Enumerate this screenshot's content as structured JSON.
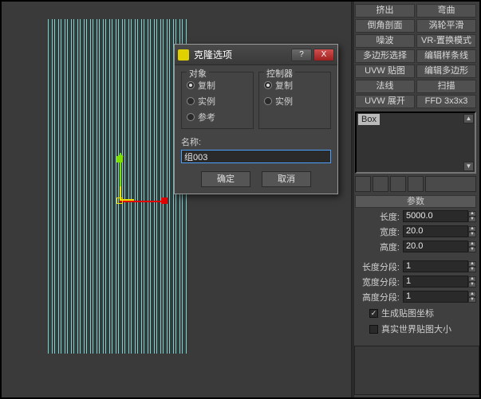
{
  "dialog": {
    "title": "克隆选项",
    "group_object": "对象",
    "group_controller": "控制器",
    "radio_copy": "复制",
    "radio_instance": "实例",
    "radio_reference": "参考",
    "name_label": "名称:",
    "name_value": "组003",
    "ok": "确定",
    "cancel": "取消",
    "help_symbol": "?",
    "close_symbol": "X"
  },
  "panel": {
    "buttons": [
      "挤出",
      "弯曲",
      "倒角剖面",
      "涡轮平滑",
      "噪波",
      "VR-置换模式",
      "多边形选择",
      "编辑样条线",
      "UVW 贴图",
      "编辑多边形",
      "法线",
      "扫描",
      "UVW 展开",
      "FFD 3x3x3"
    ],
    "stack_item": "Box",
    "rollout": "参数",
    "params": [
      {
        "label": "长度:",
        "value": "5000.0"
      },
      {
        "label": "宽度:",
        "value": "20.0"
      },
      {
        "label": "高度:",
        "value": "20.0"
      }
    ],
    "segs": [
      {
        "label": "长度分段:",
        "value": "1"
      },
      {
        "label": "宽度分段:",
        "value": "1"
      },
      {
        "label": "高度分段:",
        "value": "1"
      }
    ],
    "chk_gen": "生成贴图坐标",
    "chk_real": "真实世界贴图大小"
  }
}
